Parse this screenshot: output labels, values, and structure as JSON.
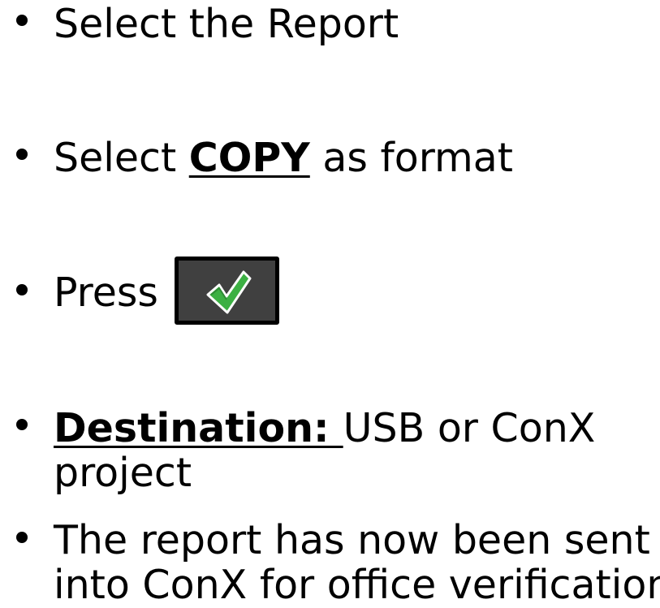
{
  "bullets": [
    {
      "text": "Select the Report"
    },
    {
      "before": "Select ",
      "emphasis": "COPY",
      "after": " as format"
    },
    {
      "text": "Press",
      "button_icon": "check-icon",
      "button_icon_color": "#3cb043",
      "button_bg": "#404040"
    },
    {
      "emphasis": "Destination: ",
      "after_line1": "USB or ConX",
      "line2": "project"
    },
    {
      "line1": "The report has now been sent",
      "line2": "into ConX for office verification"
    }
  ]
}
